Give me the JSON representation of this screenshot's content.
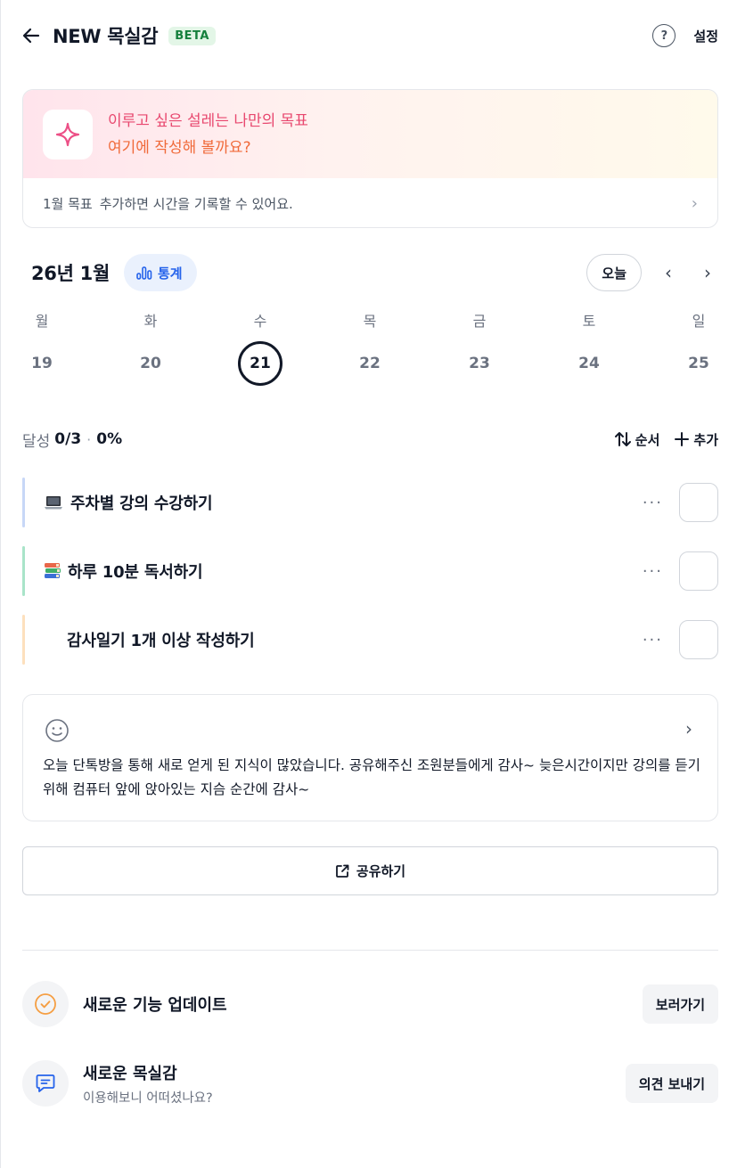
{
  "header": {
    "title": "NEW 목실감",
    "badge": "BETA",
    "help": "?",
    "settings": "설정"
  },
  "goal": {
    "line1": "이루고 싶은 설레는 나만의 목표",
    "line2": "여기에 작성해 볼까요?",
    "hint_prefix": "1월 목표",
    "hint_text": "추가하면 시간을 기록할 수 있어요."
  },
  "calendar": {
    "month": "26년 1월",
    "stats_label": "통계",
    "today_label": "오늘",
    "days": [
      {
        "day": "월",
        "date": "19"
      },
      {
        "day": "화",
        "date": "20"
      },
      {
        "day": "수",
        "date": "21"
      },
      {
        "day": "목",
        "date": "22"
      },
      {
        "day": "금",
        "date": "23"
      },
      {
        "day": "토",
        "date": "24"
      },
      {
        "day": "일",
        "date": "25"
      }
    ],
    "selected_date": "21"
  },
  "achievement": {
    "label": "달성",
    "fraction": "0/3",
    "separator": "·",
    "percent": "0%",
    "order_label": "순서",
    "add_label": "추가"
  },
  "tasks": [
    {
      "label": "주차별 강의 수강하기",
      "icon": "laptop-icon",
      "color": "#c7d7f7",
      "more": "···",
      "checked": false
    },
    {
      "label": "하루 10분 독서하기",
      "icon": "books-icon",
      "color": "#a9e4c9",
      "more": "···",
      "checked": false
    },
    {
      "label": "감사일기 1개 이상 작성하기",
      "icon": "",
      "color": "#fde0bd",
      "more": "···",
      "checked": false
    }
  ],
  "diary": {
    "text": "오늘 단톡방을 통해 새로 얻게 된 지식이 많았습니다. 공유해주신 조원분들에게 감사~ 늦은시간이지만 강의를 듣기 위해 컴퓨터 앞에 앉아있는 지슴 순간에 감사~"
  },
  "share": {
    "label": "공유하기"
  },
  "updates": {
    "title": "새로운 기능 업데이트",
    "button": "보러가기"
  },
  "feedback": {
    "title": "새로운 목실감",
    "subtitle": "이용해보니 어떠셨나요?",
    "button": "의견 보내기"
  },
  "colors": {
    "accent_blue": "#2563eb",
    "goal_pink": "#e8486f",
    "goal_orange": "#f06a3a",
    "beta_green": "#15803d",
    "update_orange": "#f59e42",
    "feedback_blue": "#2563eb"
  }
}
